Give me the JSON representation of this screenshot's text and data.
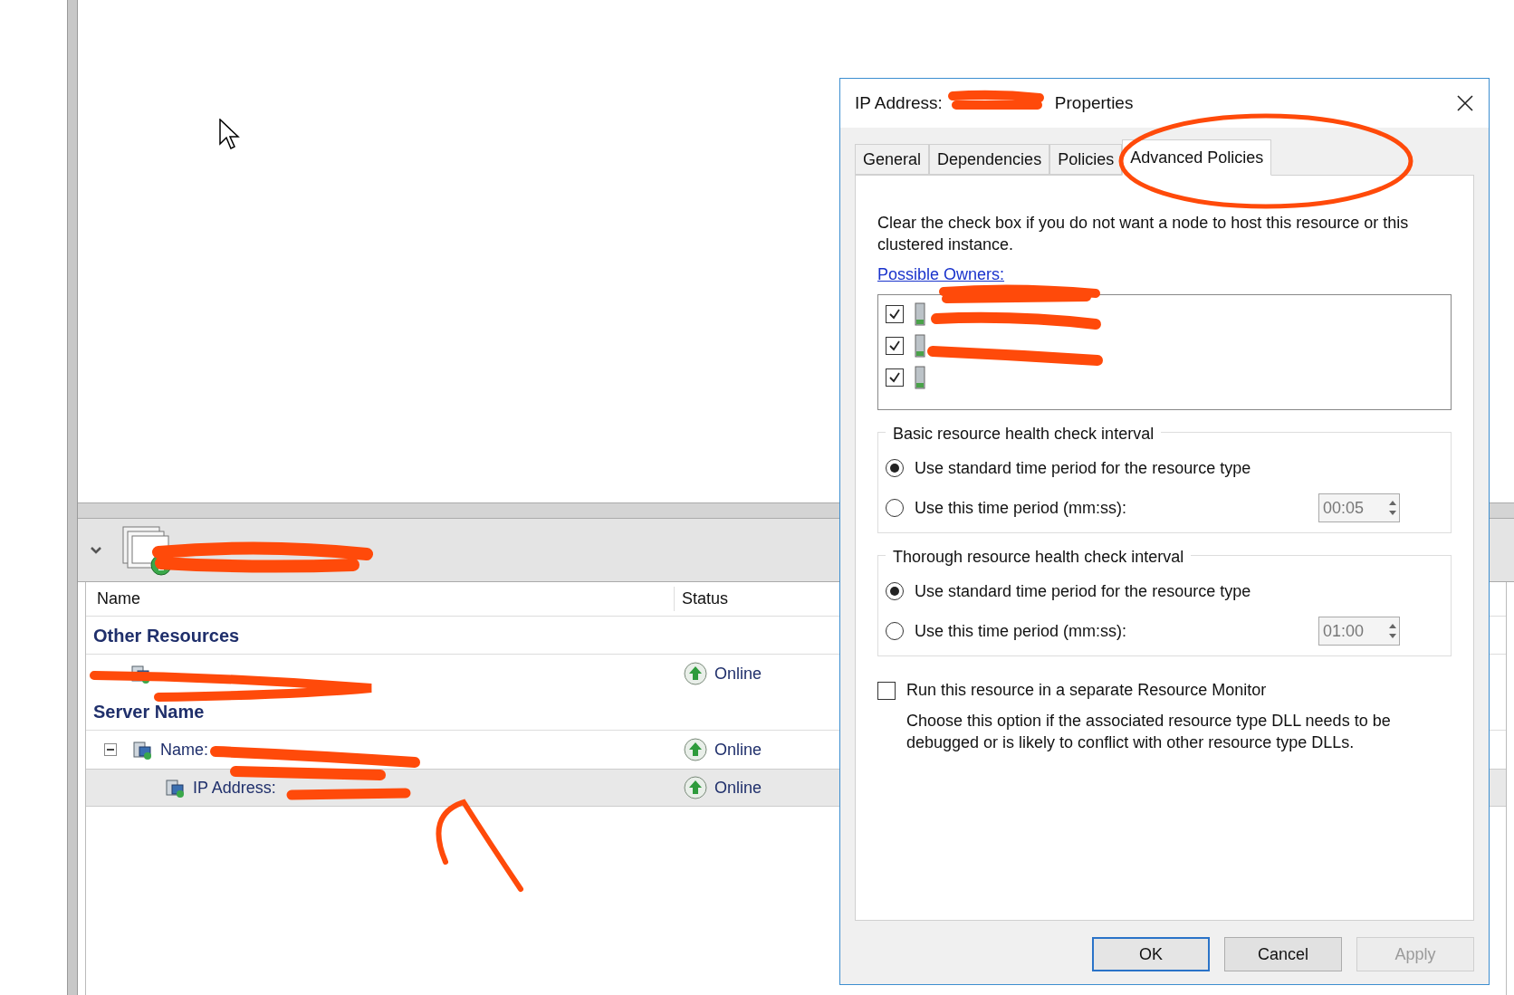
{
  "main": {
    "columns": [
      "Name",
      "Status"
    ],
    "groups": [
      {
        "title": "Other Resources",
        "rows": [
          {
            "kind": "resource",
            "label": "",
            "status": "Online",
            "selected": false
          }
        ]
      },
      {
        "title": "Server Name",
        "rows": [
          {
            "kind": "name",
            "label": "Name:",
            "status": "Online",
            "selected": false,
            "expanded": true
          },
          {
            "kind": "ip",
            "label": "IP Address:",
            "status": "Online",
            "selected": true
          }
        ]
      }
    ]
  },
  "dialog": {
    "title_start": "IP Address:",
    "title_end": "Properties",
    "tabs": [
      {
        "label": "General",
        "selected": false
      },
      {
        "label": "Dependencies",
        "selected": false
      },
      {
        "label": "Policies",
        "selected": false
      },
      {
        "label": "Advanced Policies",
        "selected": true
      }
    ],
    "description": "Clear the check box if you do not want a node to host this resource or this clustered instance.",
    "owners_link": "Possible Owners:",
    "owners": [
      {
        "checked": true
      },
      {
        "checked": true
      },
      {
        "checked": true
      }
    ],
    "intervals": [
      {
        "title": "Basic resource health check interval",
        "options": [
          {
            "label": "Use standard time period for the resource type",
            "selected": true
          },
          {
            "label": "Use this time period (mm:ss):",
            "selected": false
          }
        ],
        "value": "00:05"
      },
      {
        "title": "Thorough resource health check interval",
        "options": [
          {
            "label": "Use standard time period for the resource type",
            "selected": true
          },
          {
            "label": "Use this time period (mm:ss):",
            "selected": false
          }
        ],
        "value": "01:00"
      }
    ],
    "monitor": {
      "label": "Run this resource in a separate Resource Monitor",
      "checked": false,
      "description": "Choose this option if the associated resource type DLL needs to be debugged or is likely to conflict with other resource type DLLs."
    },
    "buttons": [
      {
        "label": "OK",
        "default": true,
        "disabled": false
      },
      {
        "label": "Cancel",
        "default": false,
        "disabled": false
      },
      {
        "label": "Apply",
        "default": false,
        "disabled": true
      }
    ]
  }
}
